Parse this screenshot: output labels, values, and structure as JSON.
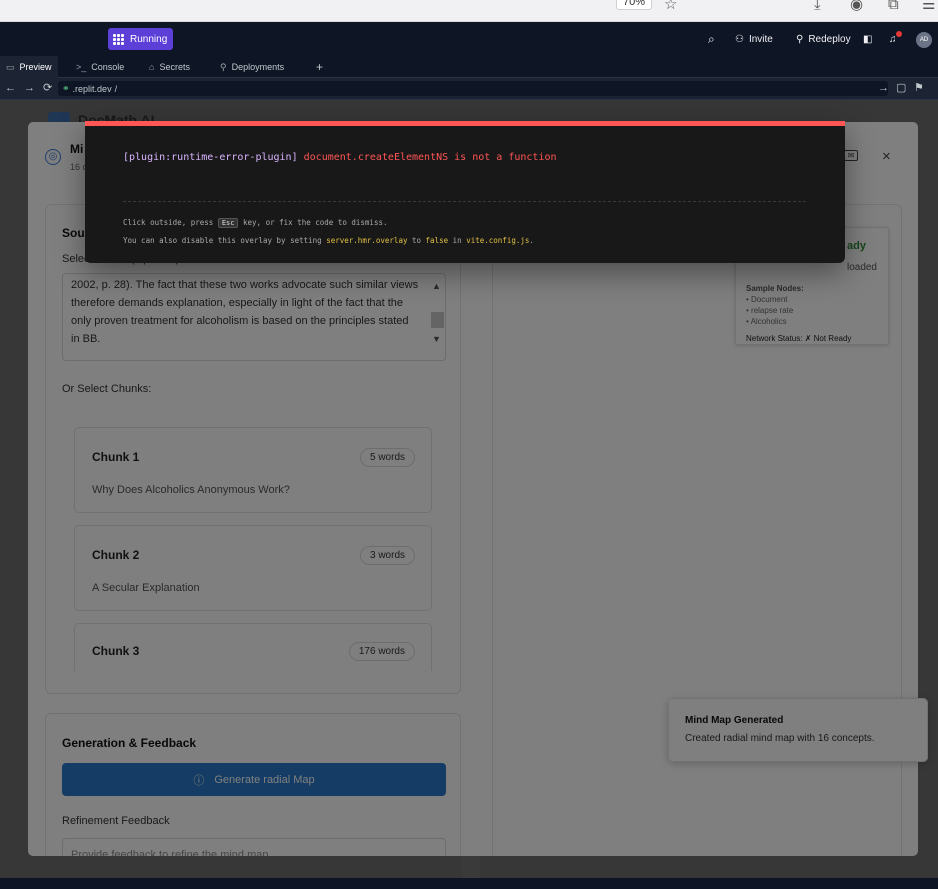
{
  "browser": {
    "zoom": "70%"
  },
  "header": {
    "run_label": "Running",
    "invite_label": "Invite",
    "redeploy_label": "Redeploy",
    "avatar_initials": "AD",
    "notif_count": "1"
  },
  "tabs": [
    {
      "label": "Preview"
    },
    {
      "label": "Console"
    },
    {
      "label": "Secrets"
    },
    {
      "label": "Deployments"
    },
    {
      "label": "+"
    }
  ],
  "url": {
    "domain": ".replit.dev",
    "path": "/"
  },
  "app": {
    "title": "DocMath AI"
  },
  "modal": {
    "title": "Mi",
    "subtitle": "16 c",
    "source_heading": "Sou",
    "selected_label": "Selected Text (Optional)",
    "selected_text": "2002, p. 28). The fact that these two works advocate such similar views therefore demands explanation, especially in light of the fact that the only proven treatment for alcoholism is based on the principles stated in BB.",
    "chunks_label": "Or Select Chunks:",
    "chunks": [
      {
        "title": "Chunk 1",
        "count": "5 words",
        "preview": "Why Does Alcoholics Anonymous Work?"
      },
      {
        "title": "Chunk 2",
        "count": "3 words",
        "preview": "A Secular Explanation"
      },
      {
        "title": "Chunk 3",
        "count": "176 words",
        "preview": ""
      }
    ],
    "generation_heading": "Generation & Feedback",
    "generate_label": "Generate radial Map",
    "refine_label": "Refinement Feedback",
    "refine_placeholder": "Provide feedback to refine the mind map...",
    "status": {
      "ready": "ady",
      "loaded": "loaded",
      "sample_heading": "Sample Nodes:",
      "nodes": [
        "• Document",
        "• relapse rate",
        "• Alcoholics"
      ],
      "network": "Network Status: ✗ Not Ready"
    }
  },
  "error": {
    "plugin": "[plugin:runtime-error-plugin]",
    "message": "document.createElementNS is not a function",
    "tip1_a": "Click outside, press",
    "tip1_key": "Esc",
    "tip1_b": "key, or fix the code to dismiss.",
    "tip2_a": "You can also disable this overlay by setting",
    "tip2_setting": "server.hmr.overlay",
    "tip2_b": "to",
    "tip2_false": "false",
    "tip2_c": "in",
    "tip2_file": "vite.config.js",
    "tip2_d": "."
  },
  "toast": {
    "title": "Mind Map Generated",
    "description": "Created radial mind map with 16 concepts."
  },
  "colors": {
    "accent": "#5b3fd6",
    "error": "#ff5555",
    "primary_button": "#2a79c9",
    "ready": "#2e8b3a"
  }
}
